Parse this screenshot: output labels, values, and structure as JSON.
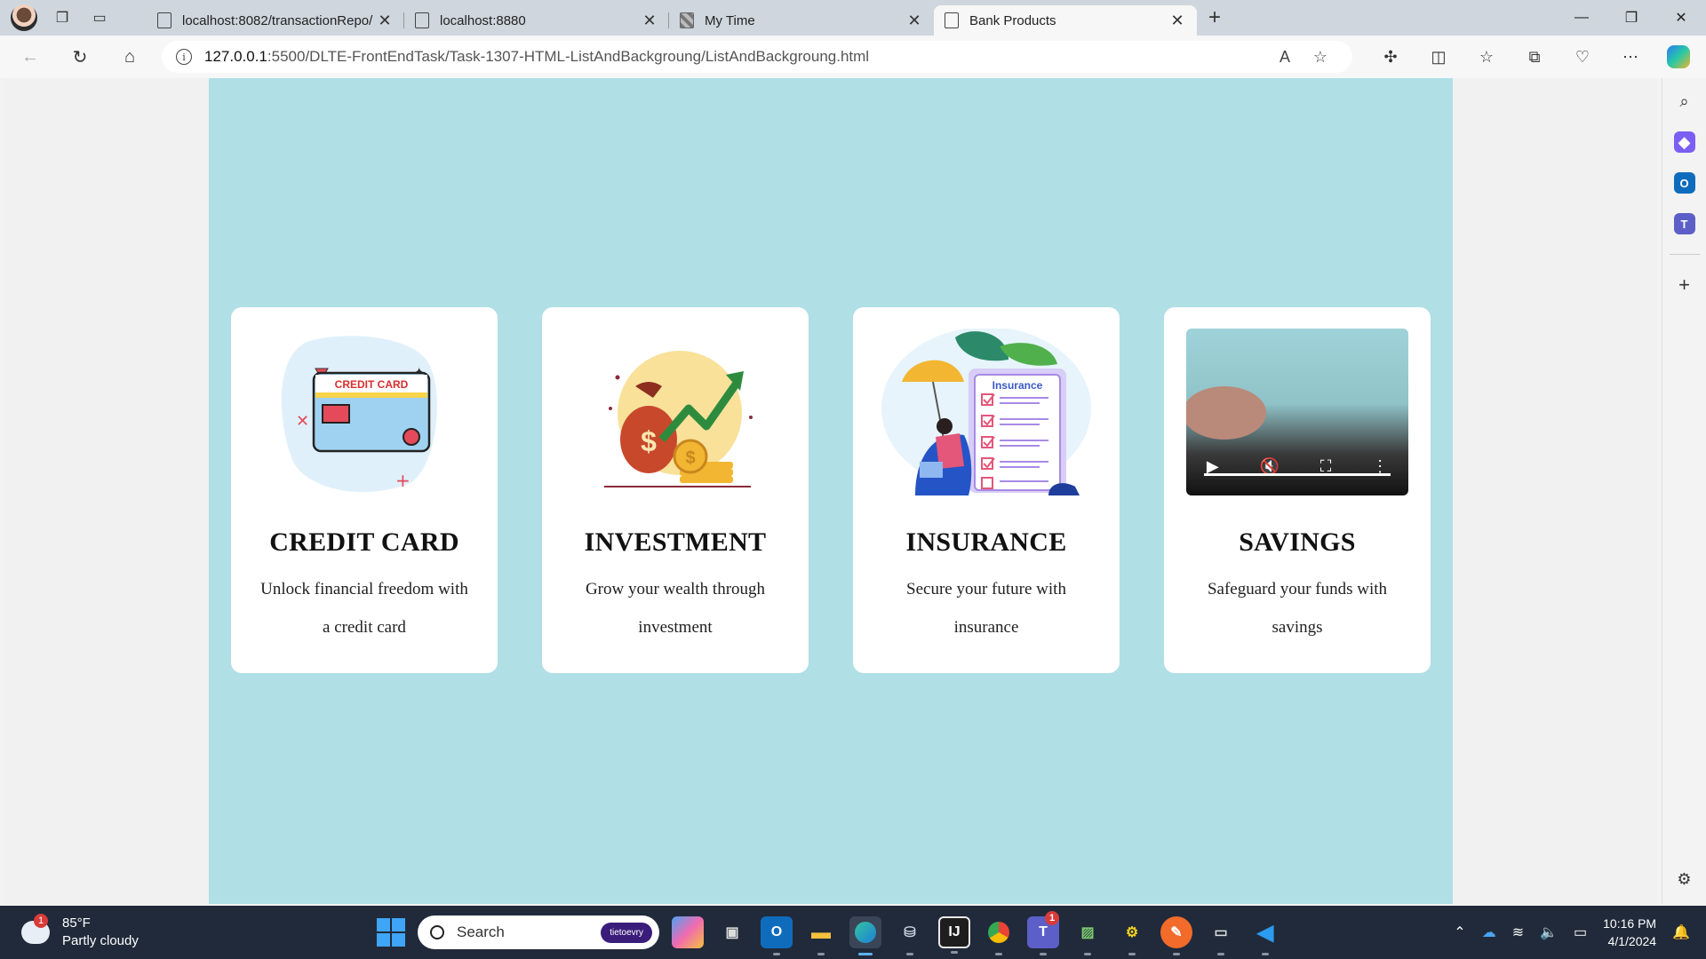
{
  "browser": {
    "tabs": [
      {
        "title": "localhost:8082/transactionRepo/",
        "close": "✕"
      },
      {
        "title": "localhost:8880",
        "close": "✕"
      },
      {
        "title": "My Time",
        "close": "✕"
      },
      {
        "title": "Bank Products",
        "close": "✕",
        "active": true
      }
    ],
    "new_tab": "+",
    "address": {
      "host": "127.0.0.1",
      "path": ":5500/DLTE-FrontEndTask/Task-1307-HTML-ListAndBackgroung/ListAndBackgroung.html"
    }
  },
  "page": {
    "cards": [
      {
        "title": "CREDIT CARD",
        "text": "Unlock financial freedom with a credit card",
        "image_label": "CREDIT CARD"
      },
      {
        "title": "INVESTMENT",
        "text": "Grow your wealth through investment"
      },
      {
        "title": "INSURANCE",
        "text": "Secure your future with insurance",
        "image_label": "Insurance"
      },
      {
        "title": "SAVINGS",
        "text": "Safeguard your funds with savings"
      }
    ]
  },
  "taskbar": {
    "weather": {
      "temp": "85°F",
      "condition": "Partly cloudy",
      "badge": "1"
    },
    "search_placeholder": "Search",
    "search_pill": "tietoevry",
    "teams_badge": "1",
    "time": "10:16 PM",
    "date": "4/1/2024"
  },
  "colors": {
    "page_bg": "#b0dfe5",
    "card_bg": "#ffffff",
    "taskbar_bg": "#202a3a"
  }
}
